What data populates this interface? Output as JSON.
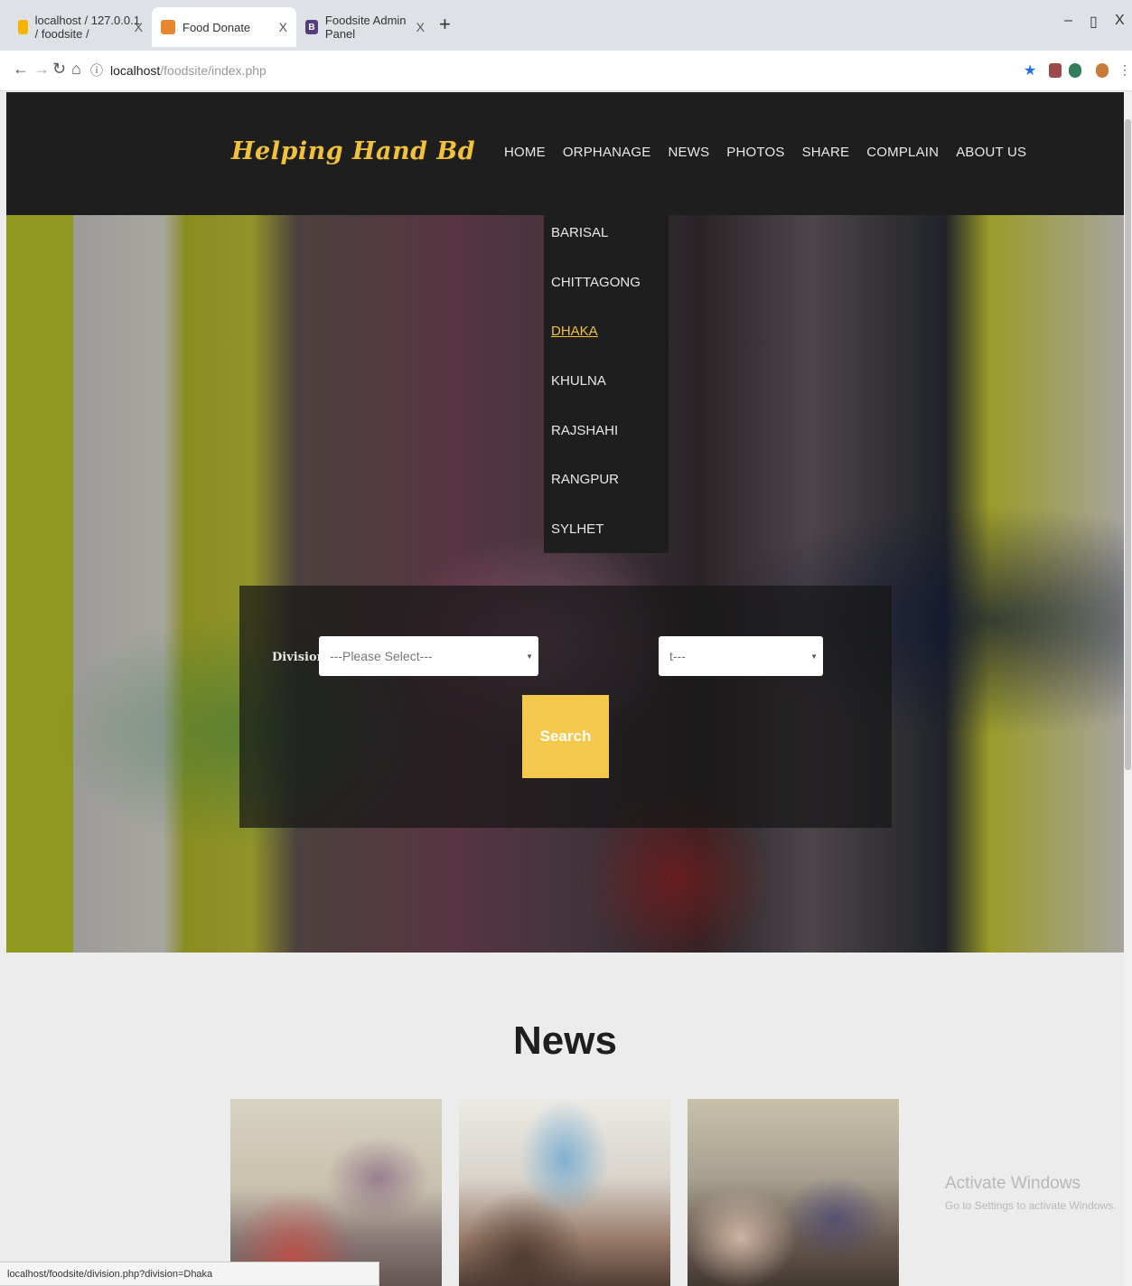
{
  "browser": {
    "tabs": [
      {
        "title": "localhost / 127.0.0.1 / foodsite / ",
        "favicon_color": "#f4b400"
      },
      {
        "title": "Food Donate",
        "favicon_color": "#e8862e"
      },
      {
        "title": "Foodsite Admin Panel",
        "favicon_color": "#563d7c",
        "favicon_letter": "B"
      }
    ],
    "close_glyph": "X",
    "new_tab_glyph": "+",
    "url_host": "localhost",
    "url_path": "/foodsite/index.php",
    "window_controls": {
      "minimize": "–",
      "restore": "▯",
      "close": "X"
    }
  },
  "site": {
    "logo": "Helping Hand Bd",
    "nav": [
      "HOME",
      "ORPHANAGE",
      "NEWS",
      "PHOTOS",
      "SHARE",
      "COMPLAIN",
      "ABOUT US"
    ],
    "orphanage_dropdown": [
      "BARISAL",
      "CHITTAGONG",
      "DHAKA",
      "KHULNA",
      "RAJSHAHI",
      "RANGPUR",
      "SYLHET"
    ],
    "dropdown_active": "DHAKA",
    "search": {
      "division_label": "Division",
      "division_placeholder": "---Please Select---",
      "second_select_text": "t---",
      "button": "Search"
    },
    "news_heading": "News"
  },
  "os_watermark": {
    "line1": "Activate Windows",
    "line2": "Go to Settings to activate Windows."
  },
  "status_url": "localhost/foodsite/division.php?division=Dhaka",
  "colors": {
    "accent": "#f2c13b",
    "header_bg": "#1e1e1e",
    "search_button": "#f4c84a"
  }
}
